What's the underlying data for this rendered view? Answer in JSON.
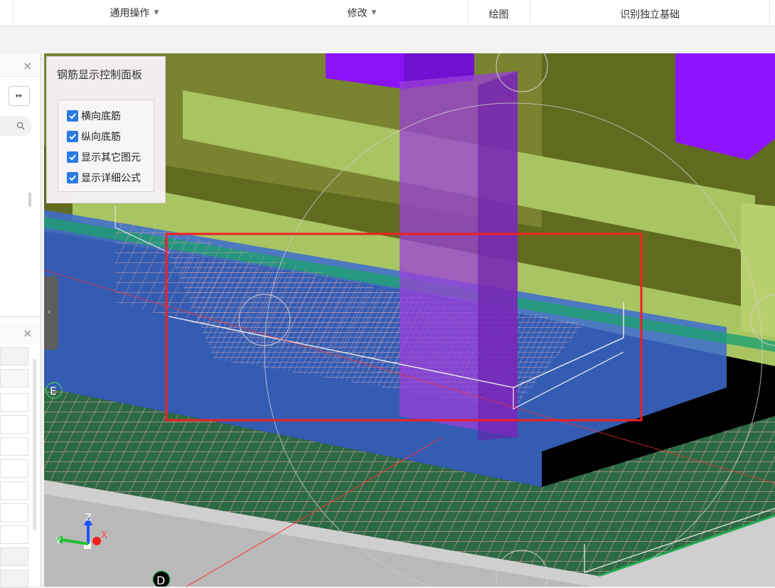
{
  "ribbon": {
    "groups": [
      {
        "label": "通用操作",
        "has_dropdown": true
      },
      {
        "label": "修改",
        "has_dropdown": true
      },
      {
        "label": "绘图",
        "has_dropdown": false
      },
      {
        "label": "识别独立基础",
        "has_dropdown": false
      }
    ]
  },
  "panel": {
    "title": "钢筋显示控制面板",
    "checkboxes": [
      {
        "label": "横向底筋",
        "checked": true
      },
      {
        "label": "纵向底筋",
        "checked": true
      },
      {
        "label": "显示其它图元",
        "checked": true
      },
      {
        "label": "显示详细公式",
        "checked": true
      }
    ]
  },
  "left_panel": {
    "close_glyph": "×",
    "expand_glyph": "▸▸",
    "search_icon": "search-icon"
  },
  "viewport": {
    "axis_labels": {
      "z": "Z",
      "y": "Y",
      "x": "X"
    },
    "grid_labels": {
      "e": "E",
      "d": "D"
    },
    "colors": {
      "background": "#000000",
      "column": "#8a00ff",
      "beam": "#a6c25e",
      "slab": "#3c6fd0",
      "ground": "#c8c8c8",
      "rebar": "#e0a0a0",
      "highlight": "#ff2020"
    }
  },
  "colors": {
    "accent": "#2a7ae2"
  }
}
